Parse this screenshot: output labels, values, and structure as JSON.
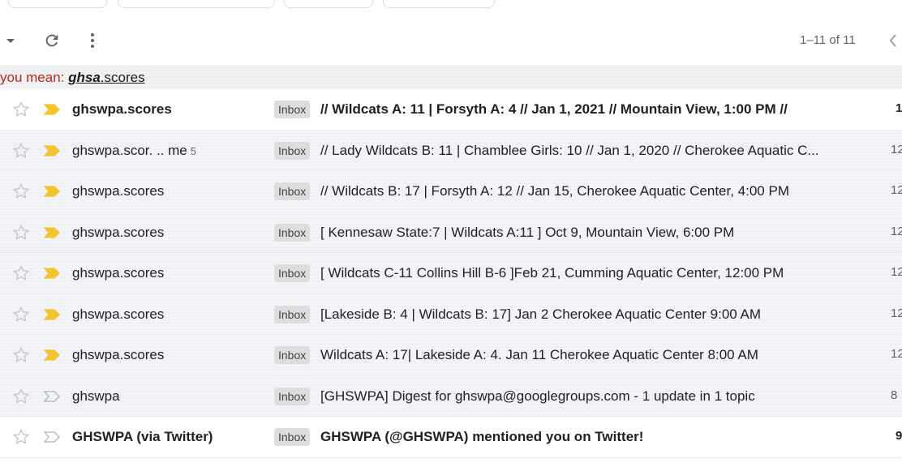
{
  "toolbar": {
    "pager_text": "1–11 of 11"
  },
  "did_you_mean": {
    "prefix": "you mean: ",
    "suggestion_bold": "ghsa",
    "suggestion_rest": ".scores"
  },
  "colors": {
    "important_marker": "#f4c430",
    "unread_bg": "#ffffff",
    "read_bg": "#f2f6fc",
    "did_you_mean_red": "#c5221f"
  },
  "emails": [
    {
      "sender": "ghswpa.scores",
      "count": "",
      "label": "Inbox",
      "subject": "// Wildcats A: 11 | Forsyth A: 4 // Jan 1, 2021 // Mountain View, 1:00 PM //",
      "date": "1",
      "unread": true,
      "important": true
    },
    {
      "sender": "ghswpa.scor. .. me",
      "count": "5",
      "label": "Inbox",
      "subject": "// Lady Wildcats B: 11 | Chamblee Girls: 10 // Jan 1, 2020 // Cherokee Aquatic C...",
      "date": "12",
      "unread": false,
      "important": true
    },
    {
      "sender": "ghswpa.scores",
      "count": "",
      "label": "Inbox",
      "subject": "// Wildcats B: 17 | Forsyth A: 12 // Jan 15, Cherokee Aquatic Center, 4:00 PM",
      "date": "12",
      "unread": false,
      "important": true
    },
    {
      "sender": "ghswpa.scores",
      "count": "",
      "label": "Inbox",
      "subject": "[ Kennesaw State:7 | Wildcats A:11 ] Oct 9, Mountain View, 6:00 PM",
      "date": "12",
      "unread": false,
      "important": true
    },
    {
      "sender": "ghswpa.scores",
      "count": "",
      "label": "Inbox",
      "subject": "[ Wildcats C-11 Collins Hill B-6 ]Feb 21, Cumming Aquatic Center, 12:00 PM",
      "date": "12",
      "unread": false,
      "important": true
    },
    {
      "sender": "ghswpa.scores",
      "count": "",
      "label": "Inbox",
      "subject": "[Lakeside B: 4 | Wildcats B: 17] Jan 2 Cherokee Aquatic Center 9:00 AM",
      "date": "12",
      "unread": false,
      "important": true
    },
    {
      "sender": "ghswpa.scores",
      "count": "",
      "label": "Inbox",
      "subject": "Wildcats A: 17| Lakeside A: 4. Jan 11 Cherokee Aquatic Center 8:00 AM",
      "date": "12",
      "unread": false,
      "important": true
    },
    {
      "sender": "ghswpa",
      "count": "",
      "label": "Inbox",
      "subject": "[GHSWPA] Digest for ghswpa@googlegroups.com - 1 update in 1 topic",
      "date": "8",
      "unread": false,
      "important": false
    },
    {
      "sender": "GHSWPA (via Twitter)",
      "count": "",
      "label": "Inbox",
      "subject": "GHSWPA (@GHSWPA) mentioned you on Twitter!",
      "date": "9",
      "unread": true,
      "important": false
    }
  ]
}
